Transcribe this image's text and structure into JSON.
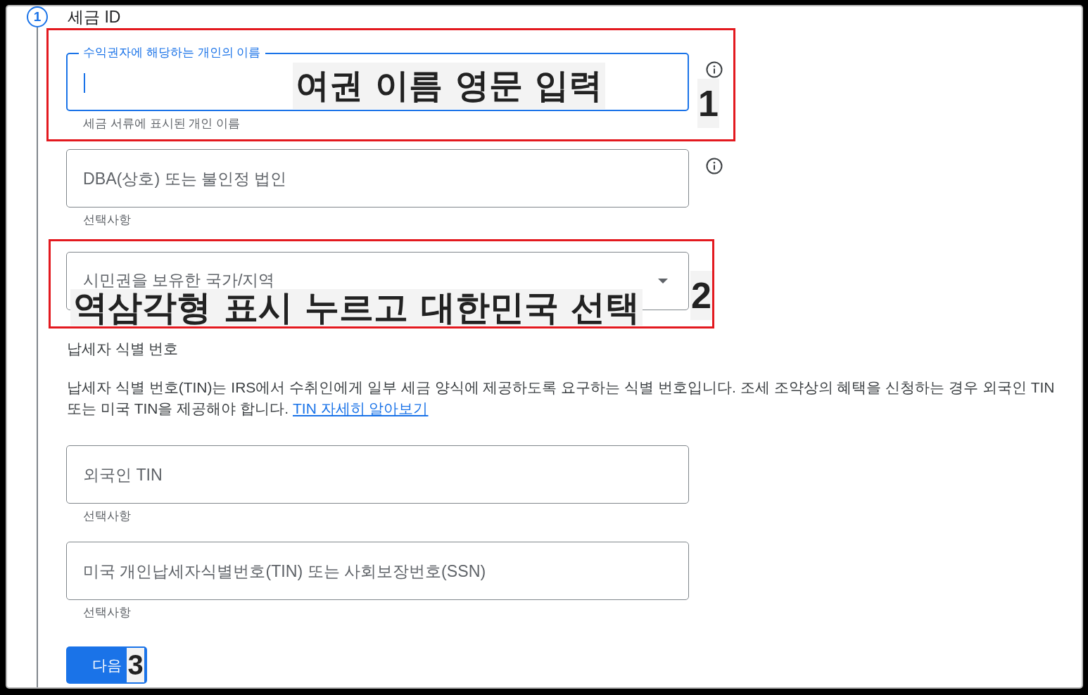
{
  "step": {
    "number": "1",
    "title": "세금 ID"
  },
  "fields": [
    {
      "kind": "text",
      "label": "수익권자에 해당하는 개인의 이름",
      "focused": true,
      "helper": "세금 서류에 표시된 개인 이름",
      "info": true,
      "callout": {
        "number": "1",
        "note": "여권 이름 영문 입력",
        "framed": true
      }
    },
    {
      "kind": "text",
      "label": "DBA(상호) 또는 불인정 법인",
      "focused": false,
      "helper": "선택사항",
      "info": true
    },
    {
      "kind": "select",
      "label": "시민권을 보유한 국가/지역",
      "focused": false,
      "info": false,
      "callout": {
        "number": "2",
        "note": "역삼각형 표시 누르고 대한민국 선택",
        "framed": true
      }
    }
  ],
  "tin": {
    "heading": "납세자 식별 번호",
    "description": "납세자 식별 번호(TIN)는 IRS에서 수취인에게 일부 세금 양식에 제공하도록 요구하는 식별 번호입니다. 조세 조약상의 혜택을 신청하는 경우 외국인 TIN 또는 미국 TIN을 제공해야 합니다.",
    "link": "TIN 자세히 알아보기",
    "fields": [
      {
        "kind": "text",
        "label": "외국인 TIN",
        "focused": false,
        "helper": "선택사항",
        "info": false
      },
      {
        "kind": "text",
        "label": "미국 개인납세자식별번호(TIN) 또는 사회보장번호(SSN)",
        "focused": false,
        "helper": "선택사항",
        "info": false
      }
    ]
  },
  "next_button": {
    "label": "다음",
    "callout": {
      "number": "3",
      "framed": false
    }
  }
}
